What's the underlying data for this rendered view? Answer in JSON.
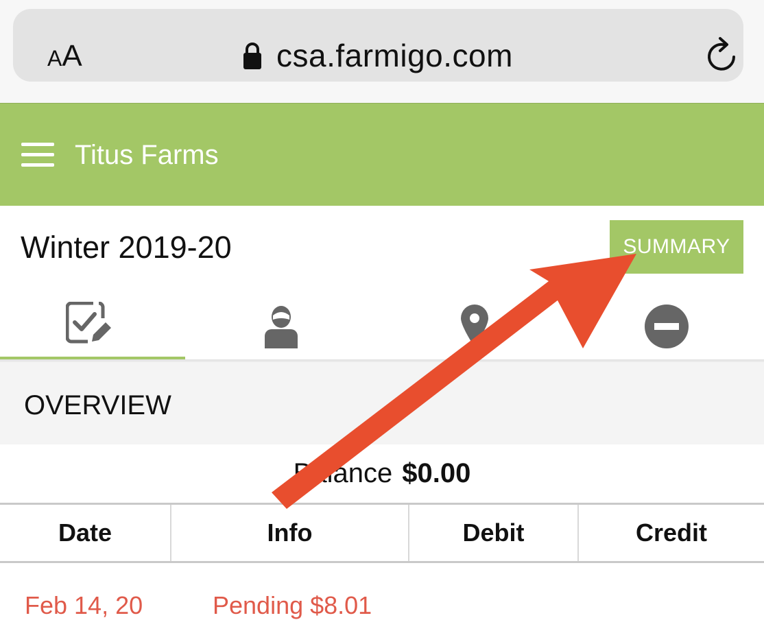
{
  "browser": {
    "text_size_button": {
      "small": "A",
      "large": "A"
    },
    "url": "csa.farmigo.com",
    "lock_icon": "lock-icon",
    "reload_icon": "reload-icon"
  },
  "header": {
    "menu_icon": "hamburger-menu-icon",
    "farm_name": "Titus Farms",
    "background_color": "#a3c766"
  },
  "season": {
    "title": "Winter 2019-20",
    "summary_label": "SUMMARY"
  },
  "tabs": [
    {
      "icon": "checklist-edit-icon",
      "active": true
    },
    {
      "icon": "user-icon",
      "active": false
    },
    {
      "icon": "location-pin-icon",
      "active": false
    },
    {
      "icon": "minus-circle-icon",
      "active": false
    }
  ],
  "overview": {
    "title": "OVERVIEW",
    "balance_label": "Balance",
    "balance_value": "$0.00"
  },
  "ledger": {
    "columns": [
      "Date",
      "Info",
      "Debit",
      "Credit"
    ],
    "rows": [
      {
        "date": "Feb 14, 20",
        "info": "Pending $8.01",
        "debit": "",
        "credit": ""
      }
    ]
  },
  "annotation": {
    "arrow_color": "#e84e2e"
  }
}
